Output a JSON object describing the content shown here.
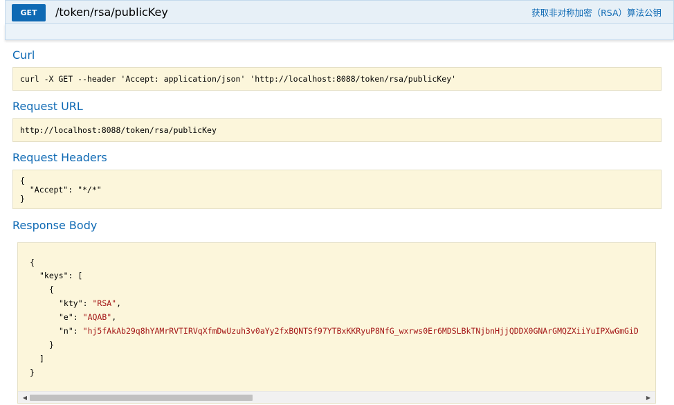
{
  "operation": {
    "method": "GET",
    "path": "/token/rsa/publicKey",
    "summary": "获取非对称加密（RSA）算法公钥"
  },
  "sections": {
    "curl": {
      "title": "Curl",
      "value": "curl -X GET --header 'Accept: application/json' 'http://localhost:8088/token/rsa/publicKey'"
    },
    "request_url": {
      "title": "Request URL",
      "value": "http://localhost:8088/token/rsa/publicKey"
    },
    "request_headers": {
      "title": "Request Headers",
      "lines": [
        "{",
        "  \"Accept\": \"*/*\"",
        "}"
      ]
    },
    "response_body": {
      "title": "Response Body",
      "open_brace": "{",
      "keys_key": "\"keys\"",
      "keys_open": ": [",
      "obj_open": "{",
      "kty_key": "\"kty\"",
      "kty_val": "\"RSA\"",
      "e_key": "\"e\"",
      "e_val": "\"AQAB\"",
      "n_key": "\"n\"",
      "n_val": "\"hj5fAkAb29q8hYAMrRVTIRVqXfmDwUzuh3v0aYy2fxBQNTSf97YTBxKKRyuP8NfG_wxrws0Er6MDSLBkTNjbnHjjQDDX0GNArGMQZXiiYuIPXwGmGiD",
      "obj_close": "}",
      "arr_close": "]",
      "close_brace": "}"
    }
  },
  "scrollbar": {
    "left_arrow": "◀",
    "right_arrow": "▶"
  },
  "colors": {
    "accent": "#0f6ab4",
    "code_bg": "#fcf6db",
    "string": "#a31515"
  }
}
